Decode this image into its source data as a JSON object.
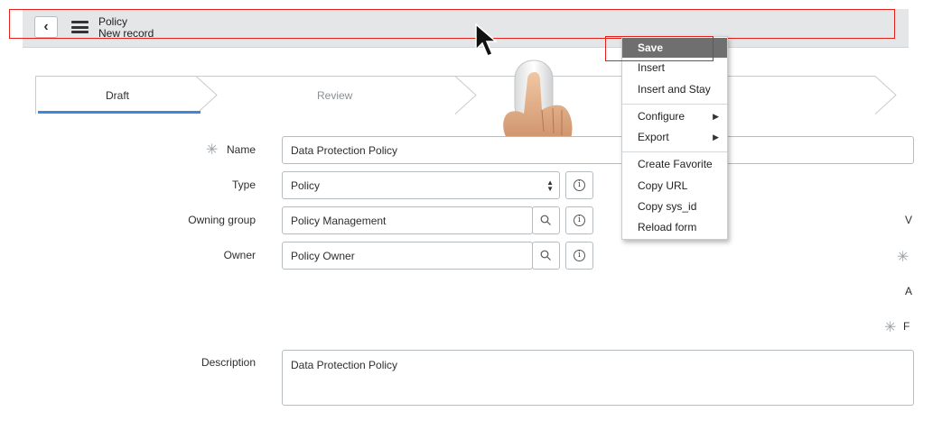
{
  "header": {
    "back_glyph": "‹",
    "title": "Policy",
    "subtitle": "New record"
  },
  "flow": {
    "stages": [
      {
        "label": "Draft",
        "active": true
      },
      {
        "label": "Review",
        "active": false
      }
    ]
  },
  "form": {
    "name": {
      "label": "Name",
      "value": "Data Protection Policy",
      "required": true
    },
    "type": {
      "label": "Type",
      "value": "Policy"
    },
    "owning_group": {
      "label": "Owning group",
      "value": "Policy Management"
    },
    "owner": {
      "label": "Owner",
      "value": "Policy Owner"
    },
    "description": {
      "label": "Description",
      "value": "Data Protection Policy"
    },
    "right_column_cut": [
      "V",
      "A",
      "F"
    ]
  },
  "context_menu": {
    "items": [
      {
        "label": "Save",
        "selected": true
      },
      {
        "label": "Insert"
      },
      {
        "label": "Insert and Stay"
      },
      {
        "label": "Configure",
        "submenu": true
      },
      {
        "label": "Export",
        "submenu": true
      },
      {
        "label": "Create Favorite"
      },
      {
        "label": "Copy URL"
      },
      {
        "label": "Copy sys_id"
      },
      {
        "label": "Reload form"
      }
    ]
  },
  "colors": {
    "header_bg": "#e4e6e7",
    "active_stage_underline": "#3f88d6",
    "annotation_red": "#e3201b",
    "menu_selected": "#6f6f6f"
  },
  "icons": [
    "back-icon",
    "hamburger-menu-icon",
    "search-icon",
    "info-icon",
    "select-arrows-icon",
    "mouse-cursor-icon",
    "required-asterisk-icon",
    "submenu-arrow-icon"
  ]
}
